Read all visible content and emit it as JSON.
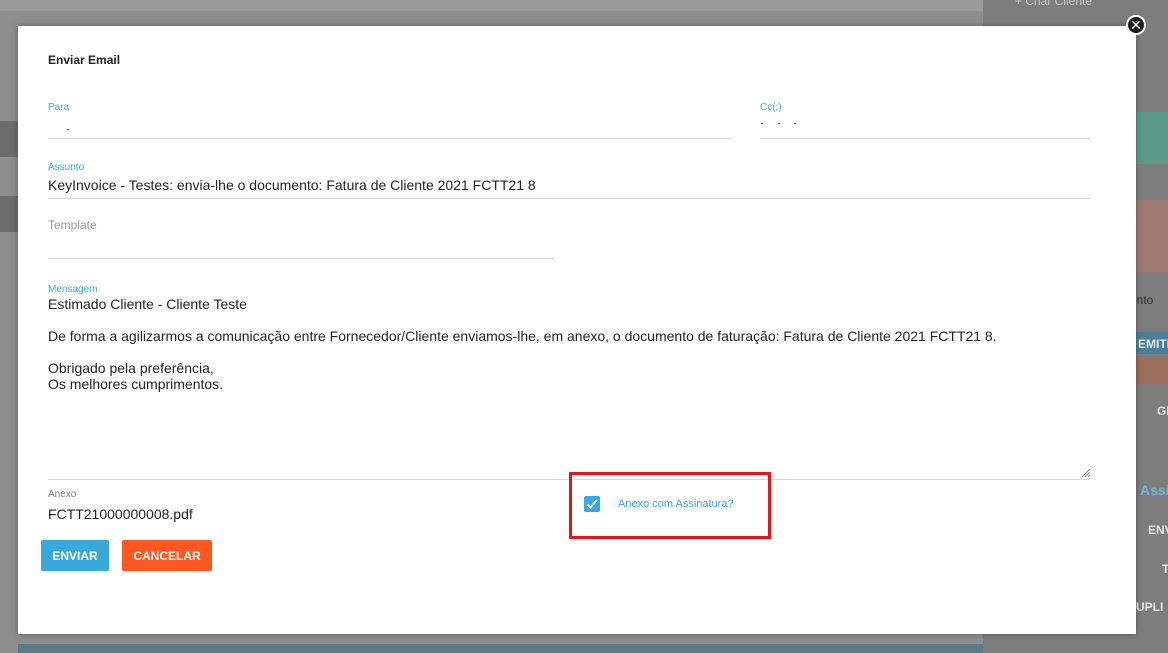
{
  "background": {
    "top_right_label": "+ Criar Cliente",
    "side_texts": [
      "ento",
      "EMITI",
      "GE",
      "Assi",
      "ENV",
      "T",
      "UPLI"
    ]
  },
  "modal": {
    "title": "Enviar Email",
    "close_icon": "close-icon",
    "para": {
      "label": "Para",
      "value": ""
    },
    "cc": {
      "label": "Cc(;)",
      "value": ""
    },
    "assunto": {
      "label": "Assunto",
      "value": "KeyInvoice - Testes: envia-lhe o documento: Fatura de Cliente 2021 FCTT21 8"
    },
    "template": {
      "placeholder": "Template"
    },
    "mensagem": {
      "label": "Mensagem",
      "value": "Estimado Cliente - Cliente Teste\n\nDe forma a agilizarmos a comunicação entre Fornecedor/Cliente enviamos-lhe, em anexo, o documento de faturação: Fatura de Cliente 2021 FCTT21 8.\n\nObrigado pela preferência,\nOs melhores cumprimentos."
    },
    "anexo": {
      "label": "Anexo",
      "value": "FCTT21000000008.pdf"
    },
    "signature_checkbox": {
      "label": "Anexo com Assinatura?",
      "checked": true
    },
    "buttons": {
      "send": "ENVIAR",
      "cancel": "CANCELAR"
    }
  },
  "colors": {
    "accent": "#39a9db",
    "cancel": "#ff5722",
    "highlight": "#e3161d"
  }
}
